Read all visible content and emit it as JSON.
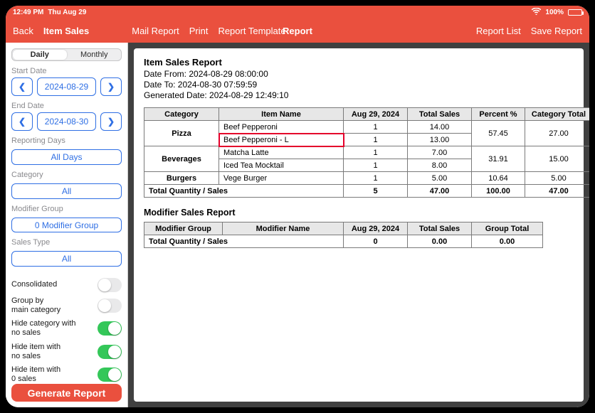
{
  "status": {
    "time": "12:49 PM",
    "date": "Thu Aug 29",
    "battery": "100%"
  },
  "nav": {
    "back": "Back",
    "title": "Item Sales",
    "mail": "Mail Report",
    "print": "Print",
    "template": "Report Template",
    "center": "Report",
    "list": "Report List",
    "save": "Save Report"
  },
  "sidebar": {
    "seg_daily": "Daily",
    "seg_monthly": "Monthly",
    "start_label": "Start Date",
    "start_date": "2024-08-29",
    "end_label": "End Date",
    "end_date": "2024-08-30",
    "reporting_label": "Reporting Days",
    "reporting_value": "All Days",
    "category_label": "Category",
    "category_value": "All",
    "modgroup_label": "Modifier Group",
    "modgroup_value": "0 Modifier Group",
    "salestype_label": "Sales Type",
    "salestype_value": "All",
    "t1": "Consolidated",
    "t2": "Group by\nmain category",
    "t3": "Hide category with\nno sales",
    "t4": "Hide item with\nno sales",
    "t5": "Hide item with\n0 sales",
    "generate": "Generate Report"
  },
  "report": {
    "title": "Item Sales Report",
    "date_from": "Date From: 2024-08-29 08:00:00",
    "date_to": "Date To: 2024-08-30 07:59:59",
    "gen": "Generated Date: 2024-08-29 12:49:10",
    "cols": {
      "cat": "Category",
      "item": "Item Name",
      "d1": "Aug 29, 2024",
      "tot": "Total Sales",
      "pct": "Percent %",
      "ctot": "Category Total"
    },
    "rows": [
      {
        "cat": "Pizza",
        "item": "Beef Pepperoni",
        "d1": "1",
        "tot": "14.00",
        "pct": "57.45",
        "ctot": "27.00",
        "catspan": 2,
        "pctspan": 2,
        "ctotspan": 2
      },
      {
        "item": "Beef Pepperoni - L",
        "d1": "1",
        "tot": "13.00",
        "hl": true
      },
      {
        "cat": "Beverages",
        "item": "Matcha Latte",
        "d1": "1",
        "tot": "7.00",
        "pct": "31.91",
        "ctot": "15.00",
        "catspan": 2,
        "pctspan": 2,
        "ctotspan": 2
      },
      {
        "item": "Iced Tea Mocktail",
        "d1": "1",
        "tot": "8.00"
      },
      {
        "cat": "Burgers",
        "item": "Vege Burger",
        "d1": "1",
        "tot": "5.00",
        "pct": "10.64",
        "ctot": "5.00"
      }
    ],
    "total": {
      "label": "Total Quantity / Sales",
      "d1": "5",
      "tot": "47.00",
      "pct": "100.00",
      "ctot": "47.00"
    },
    "mod_title": "Modifier Sales Report",
    "mod_cols": {
      "g": "Modifier Group",
      "n": "Modifier Name",
      "d1": "Aug 29, 2024",
      "tot": "Total Sales",
      "gt": "Group Total"
    },
    "mod_total": {
      "label": "Total Quantity / Sales",
      "d1": "0",
      "tot": "0.00",
      "gt": "0.00"
    }
  },
  "chart_data": {
    "type": "table",
    "title": "Item Sales Report — Aug 29, 2024",
    "columns": [
      "Category",
      "Item Name",
      "Aug 29, 2024",
      "Total Sales",
      "Percent %",
      "Category Total"
    ],
    "rows": [
      [
        "Pizza",
        "Beef Pepperoni",
        1,
        14.0,
        57.45,
        27.0
      ],
      [
        "Pizza",
        "Beef Pepperoni - L",
        1,
        13.0,
        57.45,
        27.0
      ],
      [
        "Beverages",
        "Matcha Latte",
        1,
        7.0,
        31.91,
        15.0
      ],
      [
        "Beverages",
        "Iced Tea Mocktail",
        1,
        8.0,
        31.91,
        15.0
      ],
      [
        "Burgers",
        "Vege Burger",
        1,
        5.0,
        10.64,
        5.0
      ]
    ],
    "totals": {
      "quantity": 5,
      "sales": 47.0,
      "percent": 100.0,
      "category_total": 47.0
    }
  }
}
